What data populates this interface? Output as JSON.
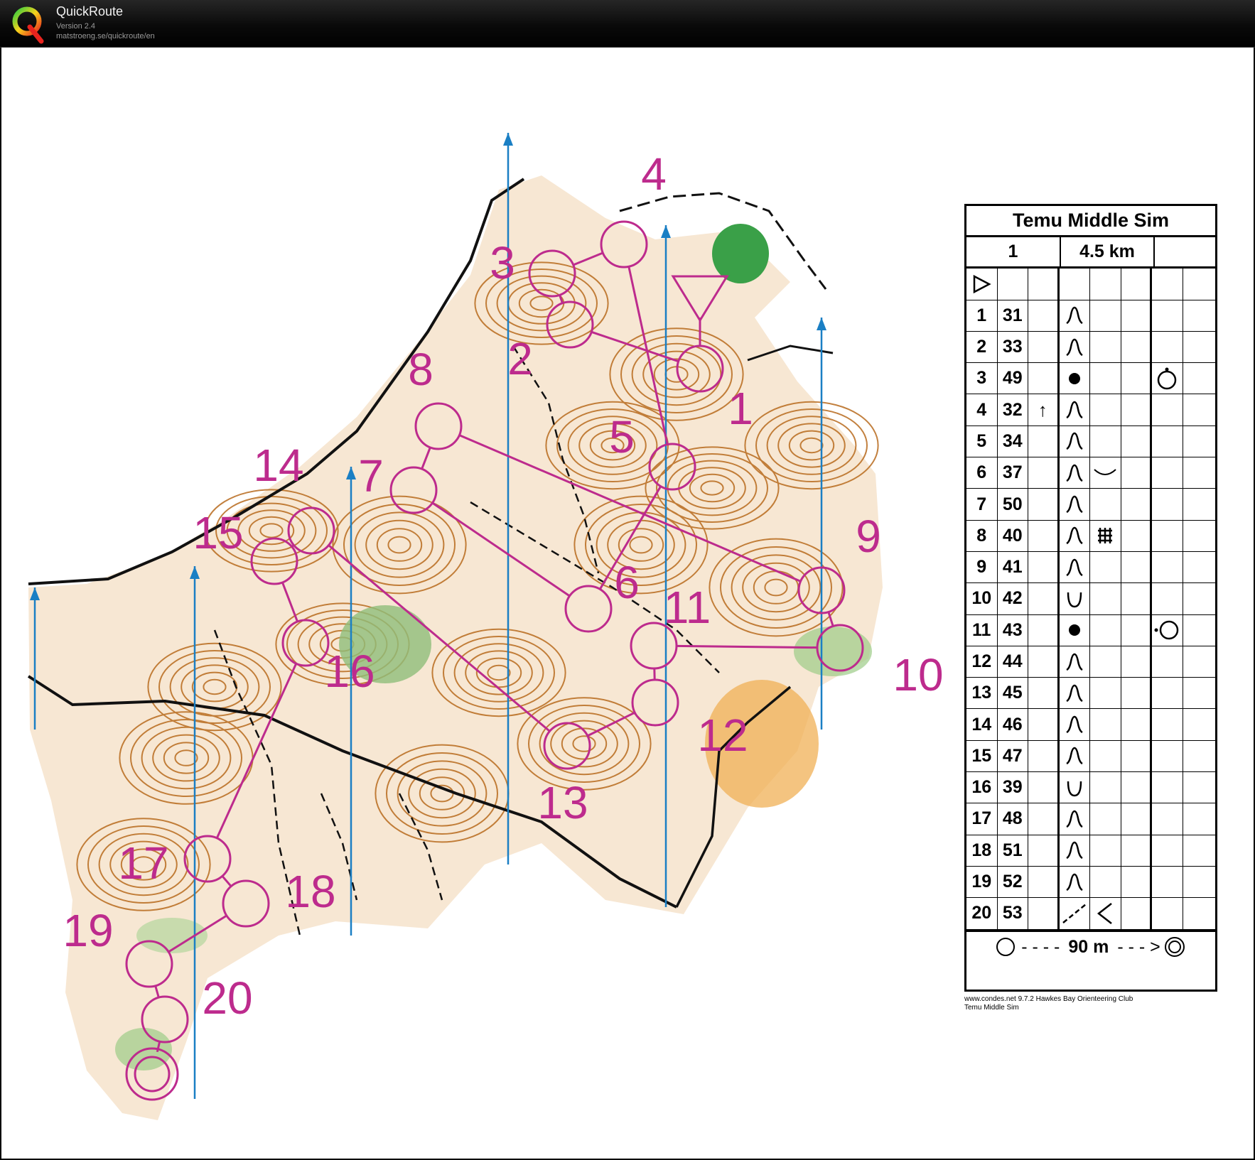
{
  "window": {
    "app_name": "QuickRoute",
    "version": "Version 2.4",
    "url": "matstroeng.se/quickroute/en"
  },
  "map": {
    "course_color": "#bd2b8d",
    "north_line_color": "#1a7fc4",
    "contour_color": "#b86b1e",
    "control_numbers": [
      "1",
      "2",
      "3",
      "4",
      "5",
      "6",
      "7",
      "8",
      "9",
      "10",
      "11",
      "12",
      "13",
      "14",
      "15",
      "16",
      "17",
      "18",
      "19",
      "20"
    ]
  },
  "description_sheet": {
    "event_name": "Temu Middle Sim",
    "course": "1",
    "length": "4.5 km",
    "start_symbol": "triangle-icon",
    "rows": [
      {
        "n": "1",
        "code": "31",
        "feature": "knoll-icon"
      },
      {
        "n": "2",
        "code": "33",
        "feature": "knoll-icon"
      },
      {
        "n": "3",
        "code": "49",
        "feature": "boulder-dot-icon",
        "pos": "top-side-icon"
      },
      {
        "n": "4",
        "code": "32",
        "dir": "↑",
        "feature": "knoll-icon"
      },
      {
        "n": "5",
        "code": "34",
        "feature": "knoll-icon"
      },
      {
        "n": "6",
        "code": "37",
        "feature": "knoll-icon",
        "detail": "shallow-curve-icon"
      },
      {
        "n": "7",
        "code": "50",
        "feature": "knoll-icon"
      },
      {
        "n": "8",
        "code": "40",
        "feature": "knoll-icon",
        "detail": "thicket-grid-icon"
      },
      {
        "n": "9",
        "code": "41",
        "feature": "knoll-icon"
      },
      {
        "n": "10",
        "code": "42",
        "feature": "depression-icon"
      },
      {
        "n": "11",
        "code": "43",
        "feature": "boulder-dot-icon",
        "pos": "left-side-icon"
      },
      {
        "n": "12",
        "code": "44",
        "feature": "knoll-icon"
      },
      {
        "n": "13",
        "code": "45",
        "feature": "knoll-icon"
      },
      {
        "n": "14",
        "code": "46",
        "feature": "knoll-icon"
      },
      {
        "n": "15",
        "code": "47",
        "feature": "knoll-icon"
      },
      {
        "n": "16",
        "code": "39",
        "feature": "depression-icon"
      },
      {
        "n": "17",
        "code": "48",
        "feature": "knoll-icon"
      },
      {
        "n": "18",
        "code": "51",
        "feature": "knoll-icon"
      },
      {
        "n": "19",
        "code": "52",
        "feature": "knoll-icon"
      },
      {
        "n": "20",
        "code": "53",
        "feature": "path-dashed-icon",
        "detail": "bend-icon"
      }
    ],
    "finish_text": "90 m",
    "footnote_1": "www.condes.net 9.7.2 Hawkes Bay Orienteering Club",
    "footnote_2": "Temu Middle Sim"
  }
}
